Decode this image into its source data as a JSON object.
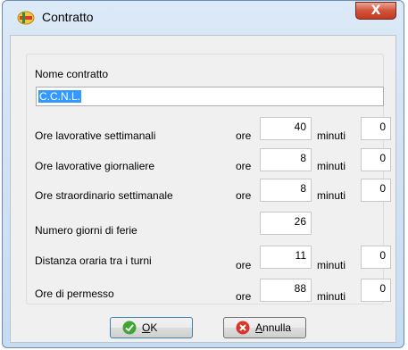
{
  "window": {
    "title": "Contratto",
    "close_symbol": "X"
  },
  "nome_contratto": {
    "label": "Nome contratto",
    "value": "C.C.N.L."
  },
  "rows": [
    {
      "label": "Ore lavorative settimanali",
      "ore_label": "ore",
      "ore": "40",
      "minuti_label": "minuti",
      "minuti": "0"
    },
    {
      "label": "Ore lavorative giornaliere",
      "ore_label": "ore",
      "ore": "8",
      "minuti_label": "minuti",
      "minuti": "0"
    },
    {
      "label": "Ore straordinario settimanale",
      "ore_label": "ore",
      "ore": "8",
      "minuti_label": "minuti",
      "minuti": "0"
    },
    {
      "label": "Numero giorni di ferie",
      "ore": "26"
    },
    {
      "label": "Distanza oraria tra i turni",
      "ore_label": "ore",
      "ore": "11",
      "minuti_label": "minuti",
      "minuti": "0"
    },
    {
      "label": "Ore di permesso",
      "ore_label": "ore",
      "ore": "88",
      "minuti_label": "minuti",
      "minuti": "0"
    }
  ],
  "buttons": {
    "ok": {
      "accel": "O",
      "rest": "K",
      "icon": "check-icon"
    },
    "cancel": {
      "accel": "A",
      "rest": "nnulla",
      "icon": "cancel-icon"
    }
  },
  "colors": {
    "ok_icon": "#3fa535",
    "cancel_icon": "#d9352a",
    "selection": "#3399ff"
  }
}
